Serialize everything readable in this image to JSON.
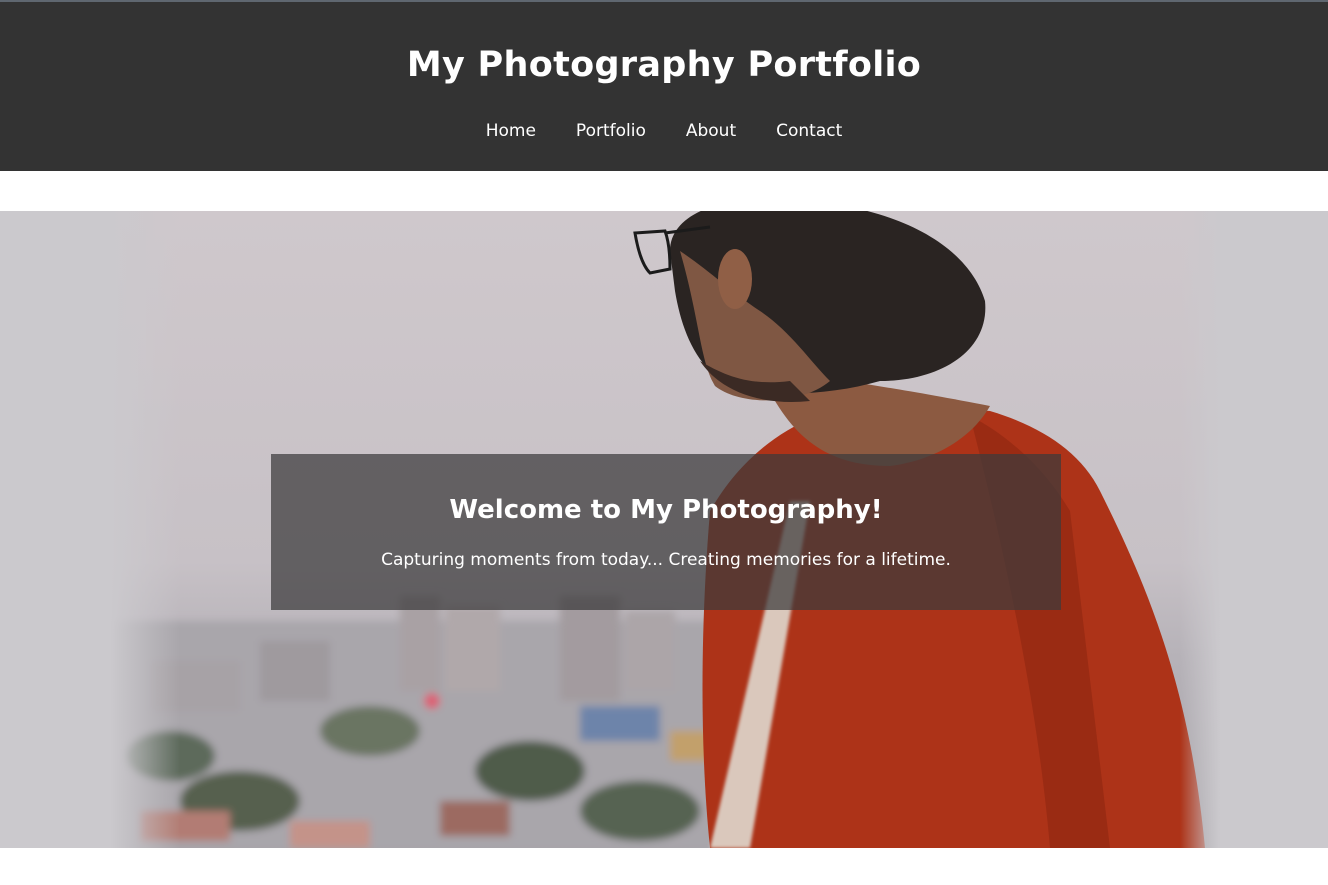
{
  "header": {
    "title": "My Photography Portfolio",
    "nav": [
      {
        "label": "Home"
      },
      {
        "label": "Portfolio"
      },
      {
        "label": "About"
      },
      {
        "label": "Contact"
      }
    ]
  },
  "hero": {
    "heading": "Welcome to My Photography!",
    "tagline": "Capturing moments from today... Creating memories for a lifetime."
  },
  "colors": {
    "header_bg": "#333333",
    "overlay_bg": "rgba(60, 58, 60, 0.72)",
    "shirt": "#a8341a"
  }
}
